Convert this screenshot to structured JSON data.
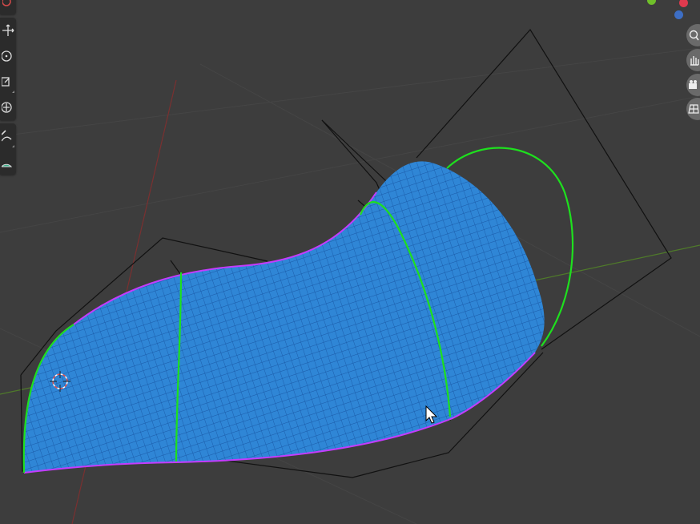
{
  "viewport": {
    "background": "#3d3d3d",
    "colors": {
      "surface": "#2f86d6",
      "surface_wire": "#1c5fb0",
      "edge_highlight": "#c43cff",
      "section_curves": "#1ee01e",
      "control_cage": "#111111",
      "x_axis": "#7a3030",
      "y_axis": "#4f7a2a",
      "grid": "#454545"
    }
  },
  "toolbar": {
    "tools": [
      {
        "name": "cursor-tool",
        "icon": "cursor-icon"
      },
      {
        "name": "move-tool",
        "icon": "move-icon"
      },
      {
        "name": "rotate-tool",
        "icon": "rotate-icon"
      },
      {
        "name": "scale-tool",
        "icon": "scale-icon"
      },
      {
        "name": "transform-tool",
        "icon": "transform-icon"
      },
      {
        "name": "annotate-tool",
        "icon": "annotate-icon"
      },
      {
        "name": "measure-tool",
        "icon": "measure-icon"
      }
    ]
  },
  "navigation": {
    "buttons": [
      {
        "name": "zoom-button",
        "icon": "magnifier-icon"
      },
      {
        "name": "pan-button",
        "icon": "hand-icon"
      },
      {
        "name": "camera-button",
        "icon": "camera-icon"
      },
      {
        "name": "perspective-button",
        "icon": "grid-icon"
      }
    ],
    "axis_colors": [
      "#6fbf2a",
      "#e03a4e",
      "#3d6ec4"
    ]
  }
}
